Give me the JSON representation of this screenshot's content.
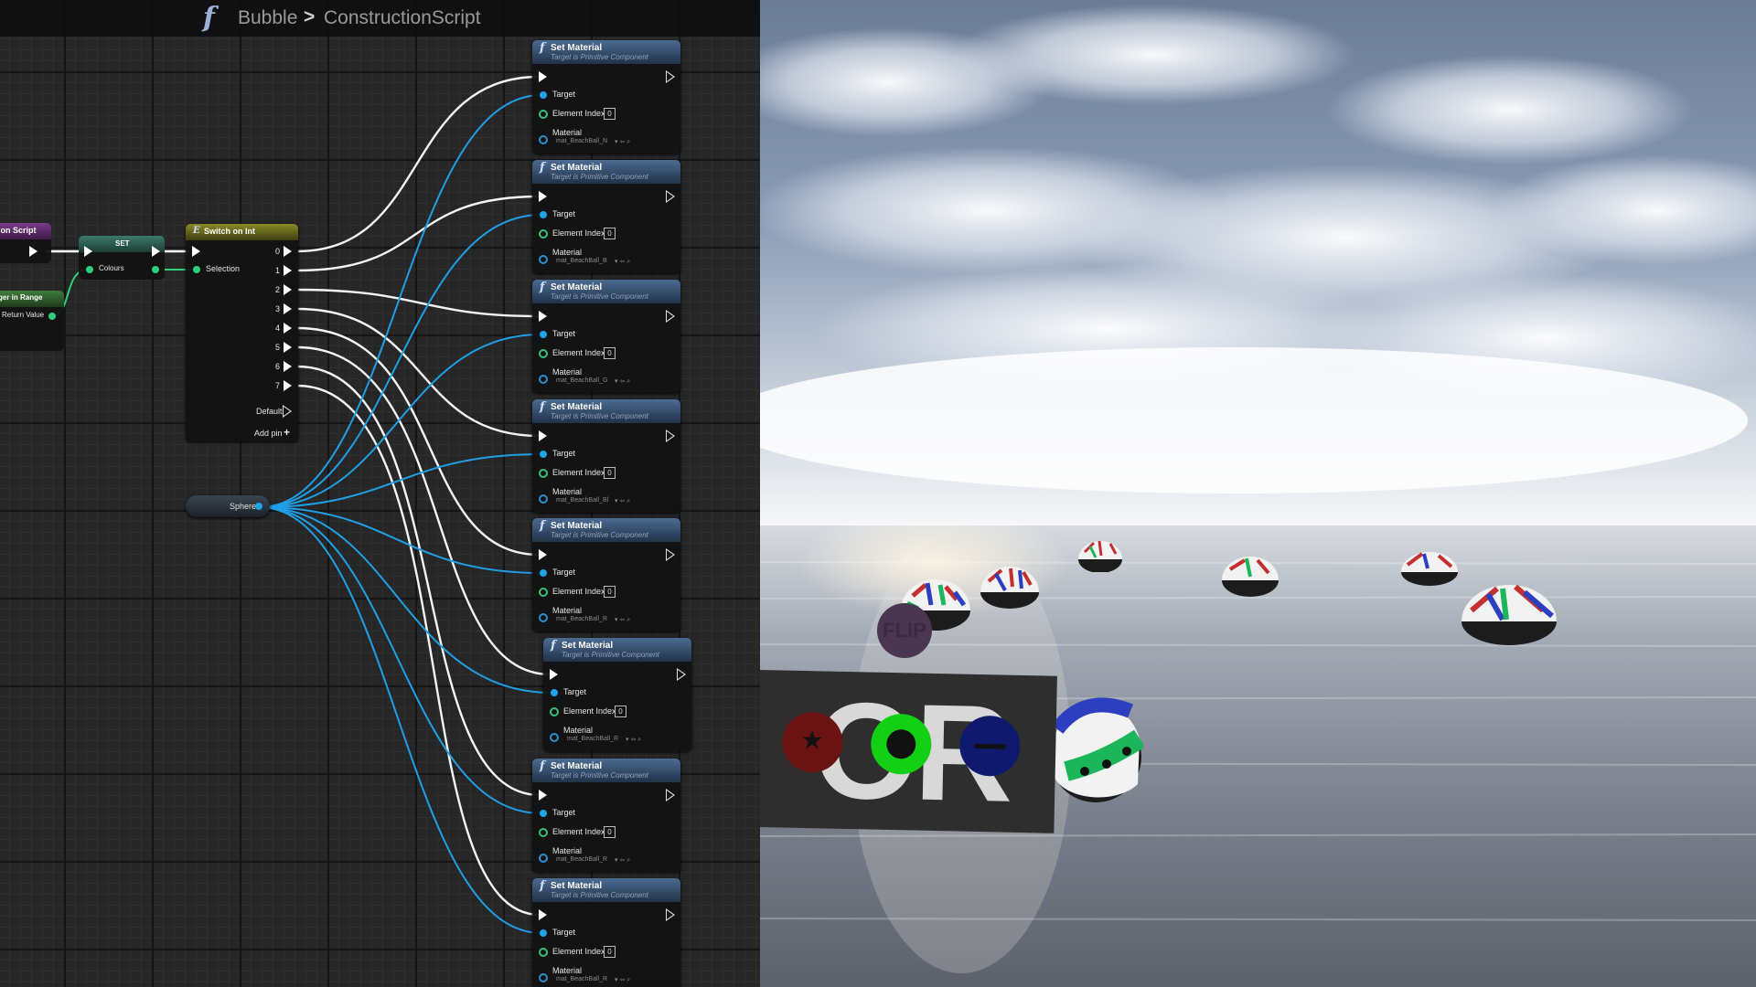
{
  "breadcrumb": {
    "function_icon": "f",
    "blueprint": "Bubble",
    "separator": ">",
    "graph": "ConstructionScript"
  },
  "left_nodes": {
    "construction_script_partial": "ion Script",
    "set_node": {
      "title": "SET",
      "pin": "Colours"
    },
    "random_int_partial": {
      "title": "ger in Range",
      "pin": "Return Value"
    }
  },
  "switch_node": {
    "title": "Switch on Int",
    "selection_label": "Selection",
    "outputs": [
      "0",
      "1",
      "2",
      "3",
      "4",
      "5",
      "6",
      "7"
    ],
    "default_label": "Default",
    "add_pin_label": "Add pin"
  },
  "sphere_node": {
    "label": "Sphere"
  },
  "set_material_nodes": [
    {
      "title": "Set Material",
      "subtitle": "Target is Primitive Component",
      "target": "Target",
      "element_index": "Element Index",
      "index_value": "0",
      "material": "Material",
      "material_value": "mat_BeachBall_N"
    },
    {
      "title": "Set Material",
      "subtitle": "Target is Primitive Component",
      "target": "Target",
      "element_index": "Element Index",
      "index_value": "0",
      "material": "Material",
      "material_value": "mat_BeachBall_B"
    },
    {
      "title": "Set Material",
      "subtitle": "Target is Primitive Component",
      "target": "Target",
      "element_index": "Element Index",
      "index_value": "0",
      "material": "Material",
      "material_value": "mat_BeachBall_G"
    },
    {
      "title": "Set Material",
      "subtitle": "Target is Primitive Component",
      "target": "Target",
      "element_index": "Element Index",
      "index_value": "0",
      "material": "Material",
      "material_value": "mat_BeachBall_Bl"
    },
    {
      "title": "Set Material",
      "subtitle": "Target is Primitive Component",
      "target": "Target",
      "element_index": "Element Index",
      "index_value": "0",
      "material": "Material",
      "material_value": "mat_BeachBall_R"
    },
    {
      "title": "Set Material",
      "subtitle": "Target is Primitive Component",
      "target": "Target",
      "element_index": "Element Index",
      "index_value": "0",
      "material": "Material",
      "material_value": "mat_BeachBall_R"
    },
    {
      "title": "Set Material",
      "subtitle": "Target is Primitive Component",
      "target": "Target",
      "element_index": "Element Index",
      "index_value": "0",
      "material": "Material",
      "material_value": "mat_BeachBall_R"
    },
    {
      "title": "Set Material",
      "subtitle": "Target is Primitive Component",
      "target": "Target",
      "element_index": "Element Index",
      "index_value": "0",
      "material": "Material",
      "material_value": "mat_BeachBall_R"
    }
  ],
  "game_hud": {
    "flip_label": "FLIP",
    "panel_text": "OR",
    "colors": {
      "red_button": "#6b1212",
      "green_button": "#14d014",
      "blue_button": "#0f1a6e",
      "flip_button": "#4a3650"
    }
  }
}
